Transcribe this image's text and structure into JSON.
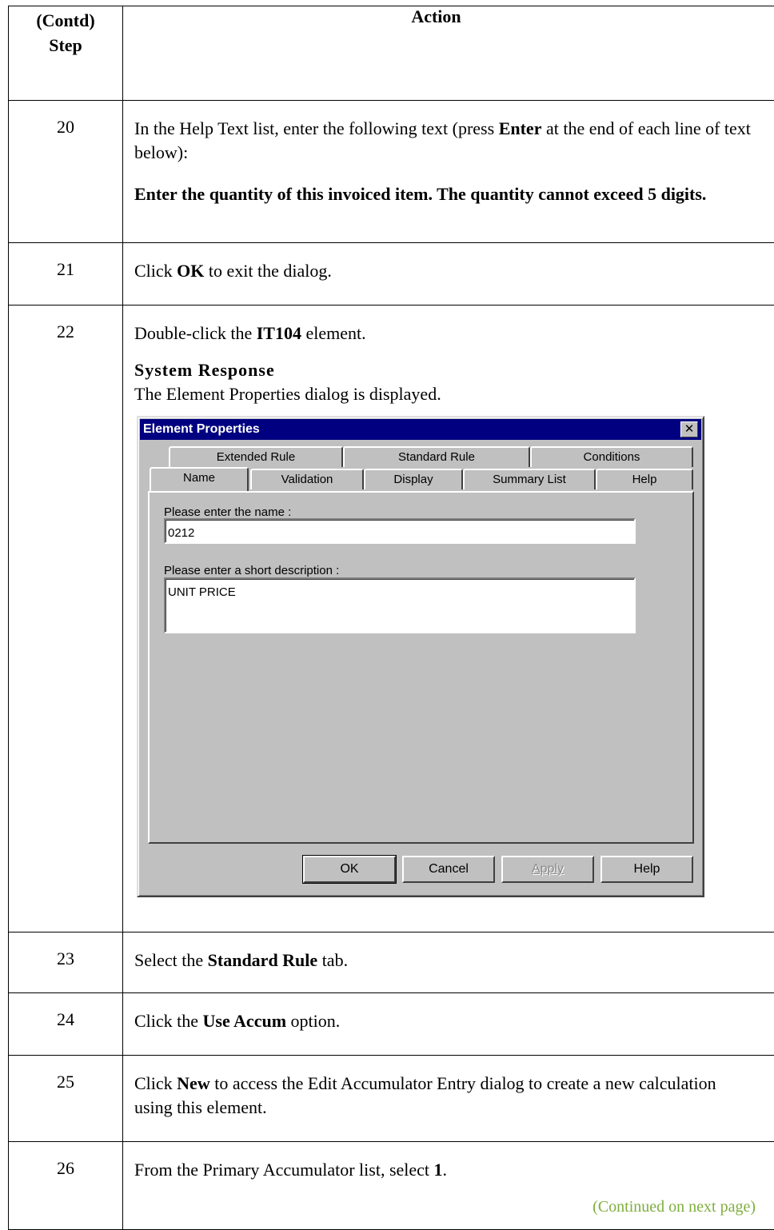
{
  "header": {
    "step_line1": "(Contd)",
    "step_line2": "Step",
    "action": "Action"
  },
  "rows": {
    "r20": {
      "num": "20",
      "t1": "In the Help Text list, enter the following text (press ",
      "b1": "Enter",
      "t2": " at the end of each line of text below):",
      "bold_text": "Enter the quantity of this invoiced item. The quantity cannot exceed 5 digits."
    },
    "r21": {
      "num": "21",
      "t1": "Click ",
      "b1": "OK",
      "t2": " to exit the dialog."
    },
    "r22": {
      "num": "22",
      "t1": "Double-click the ",
      "b1": "IT104",
      "t2": " element.",
      "system_response_label": "System Response",
      "system_response_text": "The Element Properties dialog is displayed."
    },
    "r23": {
      "num": "23",
      "t1": "Select the ",
      "b1": "Standard Rule",
      "t2": " tab."
    },
    "r24": {
      "num": "24",
      "t1": "Click the ",
      "b1": "Use Accum",
      "t2": " option."
    },
    "r25": {
      "num": "25",
      "t1": "Click ",
      "b1": "New",
      "t2": " to access the Edit Accumulator Entry dialog to create a new calculation using this element."
    },
    "r26": {
      "num": "26",
      "t1": "From the Primary Accumulator list, select ",
      "b1": "1",
      "t2": "."
    }
  },
  "continued": "(Continued on next page)",
  "dialog": {
    "title": "Element Properties",
    "close_glyph": "✕",
    "tabs_back": [
      "Extended Rule",
      "Standard Rule",
      "Conditions"
    ],
    "tabs_front": [
      "Name",
      "Validation",
      "Display",
      "Summary List",
      "Help"
    ],
    "name_label": "Please enter the name :",
    "name_value": "0212",
    "desc_label": "Please enter a short description :",
    "desc_value": "UNIT PRICE",
    "buttons": {
      "ok": "OK",
      "cancel": "Cancel",
      "apply": "Apply",
      "help": "Help"
    }
  }
}
